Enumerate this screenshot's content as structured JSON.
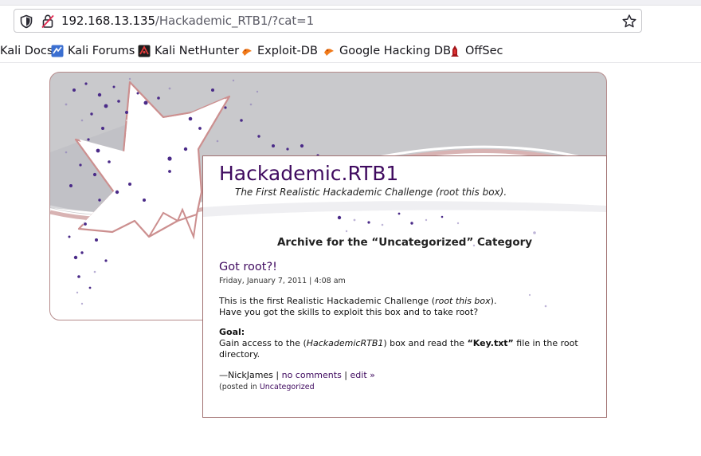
{
  "browser": {
    "url_host": "192.168.13.135",
    "url_path": "/Hackademic_RTB1/?cat=1"
  },
  "bookmarks": [
    {
      "label": "Kali Docs",
      "icon": "kali-dragon-icon"
    },
    {
      "label": "Kali Forums",
      "icon": "kali-forums-icon"
    },
    {
      "label": "Kali NetHunter",
      "icon": "nethunter-icon"
    },
    {
      "label": "Exploit-DB",
      "icon": "exploit-db-icon"
    },
    {
      "label": "Google Hacking DB",
      "icon": "ghdb-icon"
    },
    {
      "label": "OffSec",
      "icon": "offsec-icon"
    }
  ],
  "page": {
    "blog_title": "Hackademic.RTB1",
    "tagline": "The First Realistic Hackademic Challenge (root this box).",
    "archive_prefix": "Archive for the ",
    "archive_open": "“",
    "archive_category": "Uncategorized",
    "archive_close": "”",
    "archive_suffix": " Category",
    "post": {
      "title": "Got root?!",
      "date": "Friday, January 7, 2011 | 4:08 am",
      "p1_a": "This is the first ",
      "p1_b": "Realistic Hackademic Challenge",
      "p1_c": " (",
      "p1_d": "root this box",
      "p1_e": ").",
      "p1_line2": "Have you got the skills to exploit this box and to take root?",
      "goal_heading": "Goal:",
      "p2_a": "Gain access to the (",
      "p2_b": "HackademicRTB1",
      "p2_c": ") box and read the ",
      "p2_d": "“Key.txt”",
      "p2_e": " file in the root directory.",
      "author": "—NickJames",
      "sep": " | ",
      "comments": "no comments",
      "edit": "edit »",
      "posted_prefix": "(posted in ",
      "posted_category": "Uncategorized"
    }
  },
  "colors": {
    "title_purple": "#3f0a5f",
    "header_gray": "#c9c9cc",
    "border_rose": "#b58a8a"
  }
}
